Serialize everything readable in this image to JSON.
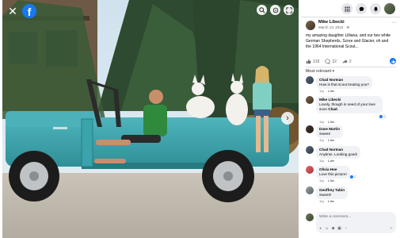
{
  "viewer": {
    "close_glyph": "✕",
    "logo_letter": "f",
    "zoom_icon": "zoom-in-icon",
    "tag_icon": "tag-icon",
    "fullscreen_icon": "fullscreen-icon",
    "next_glyph": "›"
  },
  "nav": {
    "menu_icon": "grid-menu-icon",
    "messenger_icon": "messenger-icon",
    "notifications_icon": "bell-icon"
  },
  "post": {
    "author": "Mike Libecki",
    "date": "March 13, 2015 · ⚙",
    "more": "···",
    "caption": "my amazing daughter Lilliana, and our two white German Shepherds, Scree and Glacier, oh and the 1964 International Scout...",
    "likes_count": "318",
    "comments_count": "32",
    "shares_count": "2",
    "sort_label": "Most relevant ▾"
  },
  "comments": [
    {
      "name": "Chad Norman",
      "text": "How is that scout treating you?",
      "time": "11y",
      "like": "Like",
      "reply": "Reply"
    },
    {
      "name": "Mike Libecki",
      "text_pre": "Lovely, though in need of your love soon ",
      "mention": "Chad",
      "text_post": ".",
      "time": "11y",
      "like": "Like",
      "reply": "Reply",
      "react_count": "1"
    },
    {
      "name": "Dave Martin",
      "text": "Sweet!",
      "time": "11y",
      "like": "Like",
      "reply": "Reply"
    },
    {
      "name": "Chad Norman",
      "text": "Anytime. Looking good!",
      "time": "11y",
      "like": "Like",
      "reply": "Reply"
    },
    {
      "name": "Olivia Hoe",
      "text": "Love this picture!",
      "time": "11y",
      "like": "Like",
      "reply": "Reply",
      "react_count": "1"
    },
    {
      "name": "Geoffrey Tabin",
      "text": "Sweet!!",
      "time": "11y",
      "like": "Like",
      "reply": "Reply"
    }
  ],
  "composer": {
    "placeholder": "Write a comment...",
    "icons": [
      "sticker-icon",
      "emoji-icon",
      "camera-icon",
      "gif-icon",
      "stamp-icon"
    ],
    "send_icon": "send-icon"
  },
  "colors": {
    "brand": "#1877f2",
    "truck": "#3aa6ad",
    "sky": "#bcd6e6"
  }
}
